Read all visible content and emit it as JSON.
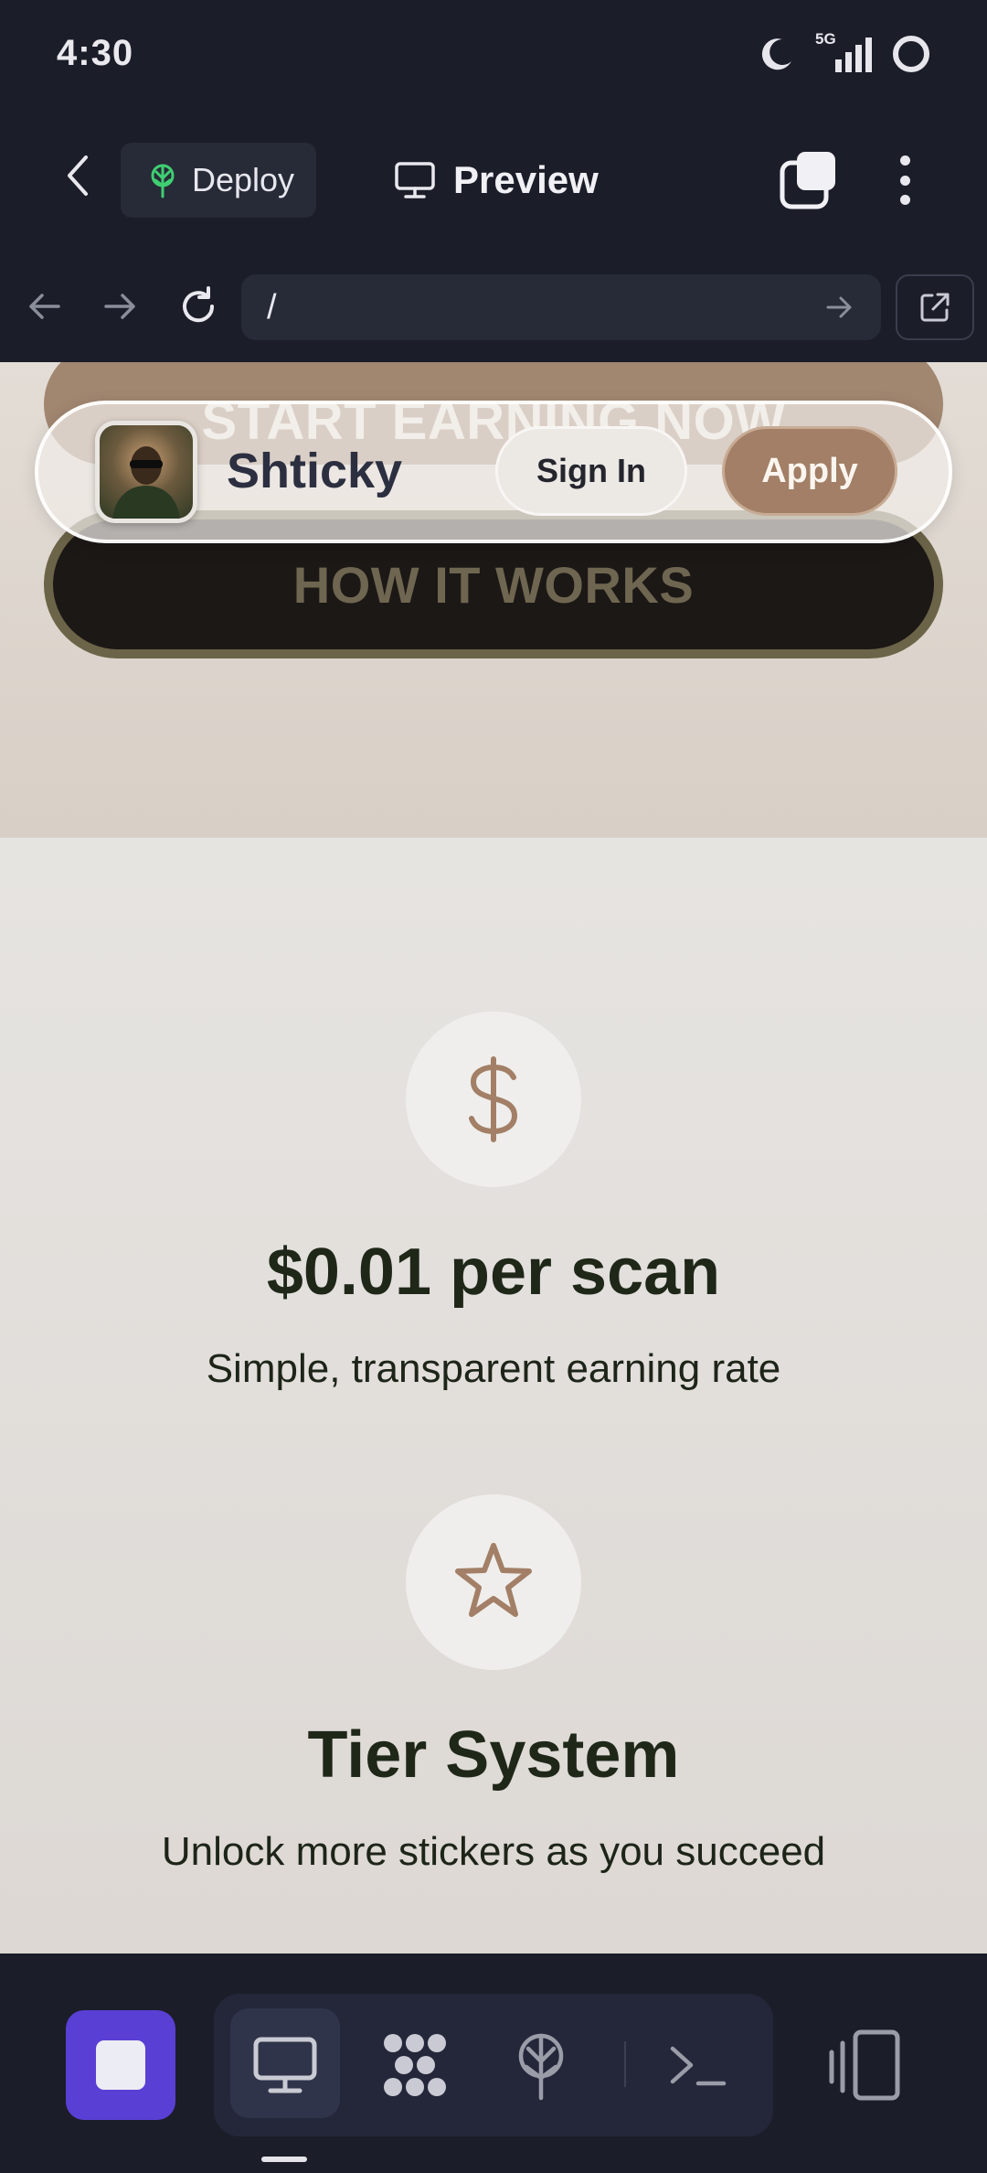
{
  "status_bar": {
    "time": "4:30",
    "network": "5G"
  },
  "toolbar": {
    "deploy_label": "Deploy",
    "preview_label": "Preview"
  },
  "browser": {
    "url": "/"
  },
  "site": {
    "brand_name": "Shticky",
    "signin_label": "Sign In",
    "apply_label": "Apply",
    "earn_cta": "START EARNING NOW",
    "how_cta": "HOW IT WORKS",
    "features": [
      {
        "icon": "dollar-icon",
        "title": "$0.01 per scan",
        "desc": "Simple, transparent earning rate"
      },
      {
        "icon": "star-icon",
        "title": "Tier System",
        "desc": "Unlock more stickers as you succeed"
      }
    ]
  },
  "colors": {
    "accent": "#a27f66",
    "stop_button": "#5a3fd4",
    "dark_bg": "#1b1d29"
  }
}
